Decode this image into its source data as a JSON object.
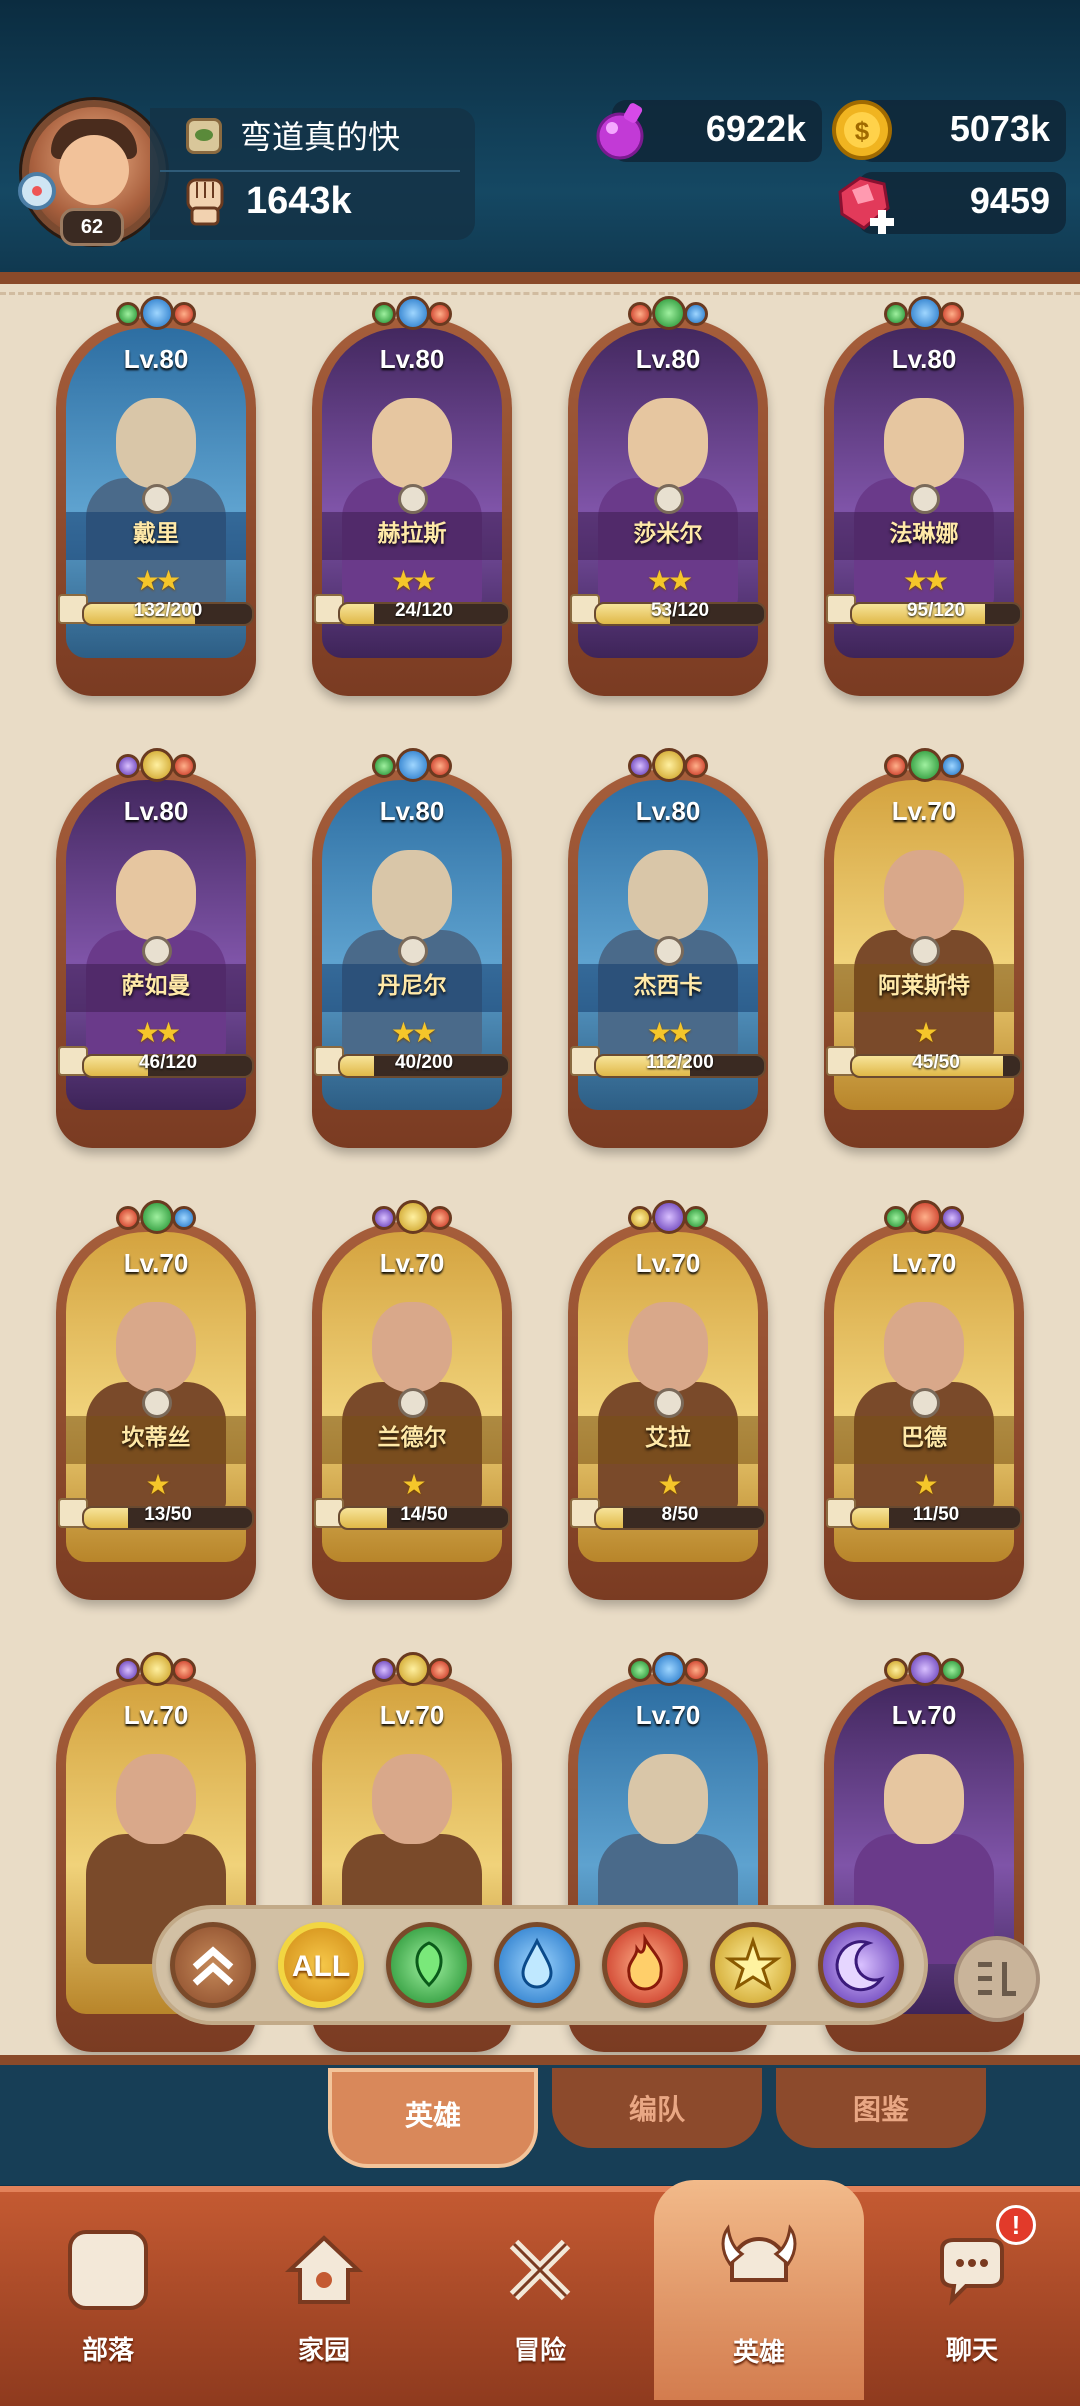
{
  "player": {
    "level": "62",
    "name": "弯道真的快",
    "power": "1643k"
  },
  "resources": {
    "elixir": "6922k",
    "gold": "5073k",
    "gems": "9459"
  },
  "heroes": [
    {
      "level": "Lv.80",
      "name": "戴里",
      "stars": "★★",
      "progress_text": "132/200",
      "progress": 0.66,
      "element": "blue",
      "bg": "blue"
    },
    {
      "level": "Lv.80",
      "name": "赫拉斯",
      "stars": "★★",
      "progress_text": "24/120",
      "progress": 0.2,
      "element": "blue",
      "bg": "purple"
    },
    {
      "level": "Lv.80",
      "name": "莎米尔",
      "stars": "★★",
      "progress_text": "53/120",
      "progress": 0.44,
      "element": "green",
      "bg": "purple"
    },
    {
      "level": "Lv.80",
      "name": "法琳娜",
      "stars": "★★",
      "progress_text": "95/120",
      "progress": 0.79,
      "element": "blue",
      "bg": "purple"
    },
    {
      "level": "Lv.80",
      "name": "萨如曼",
      "stars": "★★",
      "progress_text": "46/120",
      "progress": 0.38,
      "element": "gold",
      "bg": "purple"
    },
    {
      "level": "Lv.80",
      "name": "丹尼尔",
      "stars": "★★",
      "progress_text": "40/200",
      "progress": 0.2,
      "element": "blue",
      "bg": "blue"
    },
    {
      "level": "Lv.80",
      "name": "杰西卡",
      "stars": "★★",
      "progress_text": "112/200",
      "progress": 0.56,
      "element": "gold",
      "bg": "blue"
    },
    {
      "level": "Lv.70",
      "name": "阿莱斯特",
      "stars": "★",
      "progress_text": "45/50",
      "progress": 0.9,
      "element": "green",
      "bg": "gold"
    },
    {
      "level": "Lv.70",
      "name": "坎蒂丝",
      "stars": "★",
      "progress_text": "13/50",
      "progress": 0.26,
      "element": "green",
      "bg": "gold"
    },
    {
      "level": "Lv.70",
      "name": "兰德尔",
      "stars": "★",
      "progress_text": "14/50",
      "progress": 0.28,
      "element": "gold",
      "bg": "gold"
    },
    {
      "level": "Lv.70",
      "name": "艾拉",
      "stars": "★",
      "progress_text": "8/50",
      "progress": 0.16,
      "element": "purple",
      "bg": "gold"
    },
    {
      "level": "Lv.70",
      "name": "巴德",
      "stars": "★",
      "progress_text": "11/50",
      "progress": 0.22,
      "element": "red",
      "bg": "gold"
    },
    {
      "level": "Lv.70",
      "name": "",
      "stars": "",
      "progress_text": "",
      "progress": 0,
      "element": "gold",
      "bg": "gold"
    },
    {
      "level": "Lv.70",
      "name": "",
      "stars": "",
      "progress_text": "",
      "progress": 0,
      "element": "gold",
      "bg": "gold"
    },
    {
      "level": "Lv.70",
      "name": "",
      "stars": "",
      "progress_text": "",
      "progress": 0,
      "element": "blue",
      "bg": "blue"
    },
    {
      "level": "Lv.70",
      "name": "",
      "stars": "",
      "progress_text": "",
      "progress": 0,
      "element": "purple",
      "bg": "purple"
    }
  ],
  "filters": {
    "all_label": "ALL",
    "items": [
      "collapse-icon",
      "all",
      "green",
      "blue",
      "red",
      "gold",
      "purple"
    ]
  },
  "tabs": [
    {
      "label": "英雄",
      "active": true
    },
    {
      "label": "编队",
      "active": false
    },
    {
      "label": "图鉴",
      "active": false
    }
  ],
  "nav": [
    {
      "label": "部落",
      "icon": "tribe-banner-icon"
    },
    {
      "label": "家园",
      "icon": "home-icon"
    },
    {
      "label": "冒险",
      "icon": "crossed-swords-icon"
    },
    {
      "label": "英雄",
      "icon": "viking-helmet-icon",
      "active": true
    },
    {
      "label": "聊天",
      "icon": "chat-bubble-icon",
      "badge": "!"
    }
  ],
  "colors": {
    "accent": "#f2d642",
    "board": "#e9dcc6",
    "nav": "#c45a32"
  }
}
